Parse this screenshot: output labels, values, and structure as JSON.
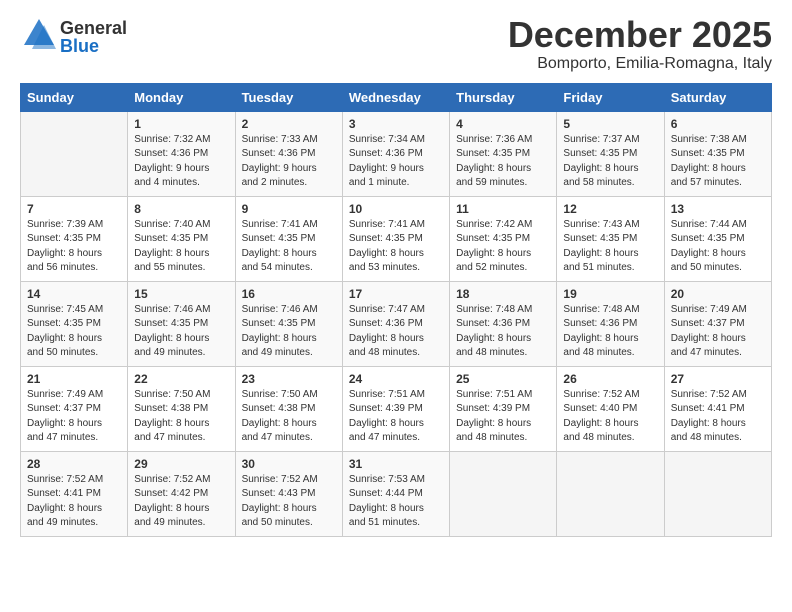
{
  "logo": {
    "general": "General",
    "blue": "Blue"
  },
  "header": {
    "month": "December 2025",
    "location": "Bomporto, Emilia-Romagna, Italy"
  },
  "days_of_week": [
    "Sunday",
    "Monday",
    "Tuesday",
    "Wednesday",
    "Thursday",
    "Friday",
    "Saturday"
  ],
  "weeks": [
    [
      {
        "day": "",
        "sunrise": "",
        "sunset": "",
        "daylight": ""
      },
      {
        "day": "1",
        "sunrise": "Sunrise: 7:32 AM",
        "sunset": "Sunset: 4:36 PM",
        "daylight": "Daylight: 9 hours and 4 minutes."
      },
      {
        "day": "2",
        "sunrise": "Sunrise: 7:33 AM",
        "sunset": "Sunset: 4:36 PM",
        "daylight": "Daylight: 9 hours and 2 minutes."
      },
      {
        "day": "3",
        "sunrise": "Sunrise: 7:34 AM",
        "sunset": "Sunset: 4:36 PM",
        "daylight": "Daylight: 9 hours and 1 minute."
      },
      {
        "day": "4",
        "sunrise": "Sunrise: 7:36 AM",
        "sunset": "Sunset: 4:35 PM",
        "daylight": "Daylight: 8 hours and 59 minutes."
      },
      {
        "day": "5",
        "sunrise": "Sunrise: 7:37 AM",
        "sunset": "Sunset: 4:35 PM",
        "daylight": "Daylight: 8 hours and 58 minutes."
      },
      {
        "day": "6",
        "sunrise": "Sunrise: 7:38 AM",
        "sunset": "Sunset: 4:35 PM",
        "daylight": "Daylight: 8 hours and 57 minutes."
      }
    ],
    [
      {
        "day": "7",
        "sunrise": "Sunrise: 7:39 AM",
        "sunset": "Sunset: 4:35 PM",
        "daylight": "Daylight: 8 hours and 56 minutes."
      },
      {
        "day": "8",
        "sunrise": "Sunrise: 7:40 AM",
        "sunset": "Sunset: 4:35 PM",
        "daylight": "Daylight: 8 hours and 55 minutes."
      },
      {
        "day": "9",
        "sunrise": "Sunrise: 7:41 AM",
        "sunset": "Sunset: 4:35 PM",
        "daylight": "Daylight: 8 hours and 54 minutes."
      },
      {
        "day": "10",
        "sunrise": "Sunrise: 7:41 AM",
        "sunset": "Sunset: 4:35 PM",
        "daylight": "Daylight: 8 hours and 53 minutes."
      },
      {
        "day": "11",
        "sunrise": "Sunrise: 7:42 AM",
        "sunset": "Sunset: 4:35 PM",
        "daylight": "Daylight: 8 hours and 52 minutes."
      },
      {
        "day": "12",
        "sunrise": "Sunrise: 7:43 AM",
        "sunset": "Sunset: 4:35 PM",
        "daylight": "Daylight: 8 hours and 51 minutes."
      },
      {
        "day": "13",
        "sunrise": "Sunrise: 7:44 AM",
        "sunset": "Sunset: 4:35 PM",
        "daylight": "Daylight: 8 hours and 50 minutes."
      }
    ],
    [
      {
        "day": "14",
        "sunrise": "Sunrise: 7:45 AM",
        "sunset": "Sunset: 4:35 PM",
        "daylight": "Daylight: 8 hours and 50 minutes."
      },
      {
        "day": "15",
        "sunrise": "Sunrise: 7:46 AM",
        "sunset": "Sunset: 4:35 PM",
        "daylight": "Daylight: 8 hours and 49 minutes."
      },
      {
        "day": "16",
        "sunrise": "Sunrise: 7:46 AM",
        "sunset": "Sunset: 4:35 PM",
        "daylight": "Daylight: 8 hours and 49 minutes."
      },
      {
        "day": "17",
        "sunrise": "Sunrise: 7:47 AM",
        "sunset": "Sunset: 4:36 PM",
        "daylight": "Daylight: 8 hours and 48 minutes."
      },
      {
        "day": "18",
        "sunrise": "Sunrise: 7:48 AM",
        "sunset": "Sunset: 4:36 PM",
        "daylight": "Daylight: 8 hours and 48 minutes."
      },
      {
        "day": "19",
        "sunrise": "Sunrise: 7:48 AM",
        "sunset": "Sunset: 4:36 PM",
        "daylight": "Daylight: 8 hours and 48 minutes."
      },
      {
        "day": "20",
        "sunrise": "Sunrise: 7:49 AM",
        "sunset": "Sunset: 4:37 PM",
        "daylight": "Daylight: 8 hours and 47 minutes."
      }
    ],
    [
      {
        "day": "21",
        "sunrise": "Sunrise: 7:49 AM",
        "sunset": "Sunset: 4:37 PM",
        "daylight": "Daylight: 8 hours and 47 minutes."
      },
      {
        "day": "22",
        "sunrise": "Sunrise: 7:50 AM",
        "sunset": "Sunset: 4:38 PM",
        "daylight": "Daylight: 8 hours and 47 minutes."
      },
      {
        "day": "23",
        "sunrise": "Sunrise: 7:50 AM",
        "sunset": "Sunset: 4:38 PM",
        "daylight": "Daylight: 8 hours and 47 minutes."
      },
      {
        "day": "24",
        "sunrise": "Sunrise: 7:51 AM",
        "sunset": "Sunset: 4:39 PM",
        "daylight": "Daylight: 8 hours and 47 minutes."
      },
      {
        "day": "25",
        "sunrise": "Sunrise: 7:51 AM",
        "sunset": "Sunset: 4:39 PM",
        "daylight": "Daylight: 8 hours and 48 minutes."
      },
      {
        "day": "26",
        "sunrise": "Sunrise: 7:52 AM",
        "sunset": "Sunset: 4:40 PM",
        "daylight": "Daylight: 8 hours and 48 minutes."
      },
      {
        "day": "27",
        "sunrise": "Sunrise: 7:52 AM",
        "sunset": "Sunset: 4:41 PM",
        "daylight": "Daylight: 8 hours and 48 minutes."
      }
    ],
    [
      {
        "day": "28",
        "sunrise": "Sunrise: 7:52 AM",
        "sunset": "Sunset: 4:41 PM",
        "daylight": "Daylight: 8 hours and 49 minutes."
      },
      {
        "day": "29",
        "sunrise": "Sunrise: 7:52 AM",
        "sunset": "Sunset: 4:42 PM",
        "daylight": "Daylight: 8 hours and 49 minutes."
      },
      {
        "day": "30",
        "sunrise": "Sunrise: 7:52 AM",
        "sunset": "Sunset: 4:43 PM",
        "daylight": "Daylight: 8 hours and 50 minutes."
      },
      {
        "day": "31",
        "sunrise": "Sunrise: 7:53 AM",
        "sunset": "Sunset: 4:44 PM",
        "daylight": "Daylight: 8 hours and 51 minutes."
      },
      {
        "day": "",
        "sunrise": "",
        "sunset": "",
        "daylight": ""
      },
      {
        "day": "",
        "sunrise": "",
        "sunset": "",
        "daylight": ""
      },
      {
        "day": "",
        "sunrise": "",
        "sunset": "",
        "daylight": ""
      }
    ]
  ]
}
